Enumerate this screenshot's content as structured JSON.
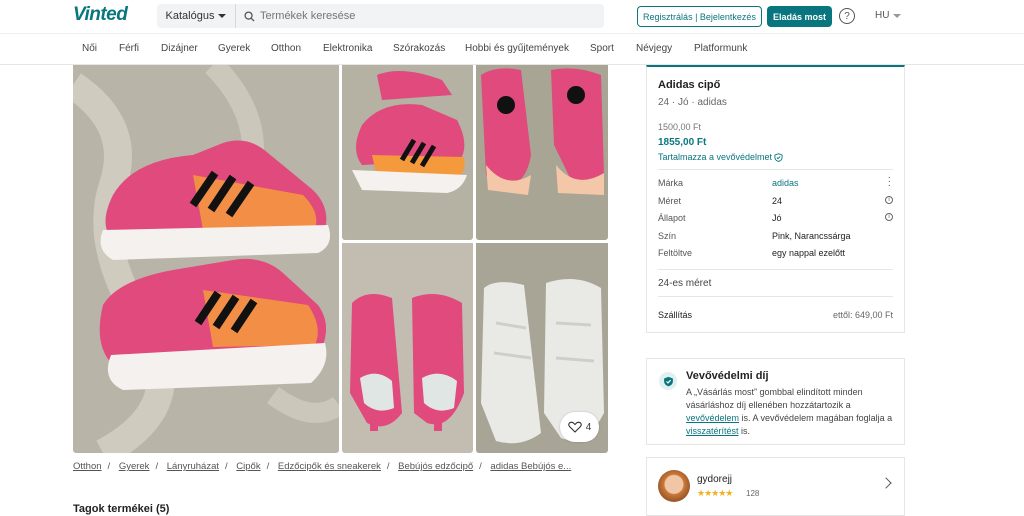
{
  "brand": "Vinted",
  "header": {
    "catalog_label": "Katalógus",
    "search_placeholder": "Termékek keresése",
    "register_label": "Regisztrálás | Bejelentkezés",
    "sell_label": "Eladás most",
    "help_icon": "question-circle-icon",
    "lang": "HU"
  },
  "nav": [
    "Női",
    "Férfi",
    "Dizájner",
    "Gyerek",
    "Otthon",
    "Elektronika",
    "Szórakozás",
    "Hobbi és gyűjtemények",
    "Sport",
    "Névjegy",
    "Platformunk"
  ],
  "gallery": {
    "favourites": "4",
    "heart_icon": "heart-outline-icon"
  },
  "breadcrumbs": [
    "Otthon",
    "Gyerek",
    "Lányruházat",
    "Cipők",
    "Edzőcipők és sneakerek",
    "Bebújós edzőcipő",
    "adidas Bebújós e..."
  ],
  "members_heading": "Tagok termékei (5)",
  "item": {
    "title": "Adidas cipő",
    "subtitle": "24 · Jó · adidas",
    "price": "1500,00 Ft",
    "price_with_protection": "1855,00 Ft",
    "protection_label": "Tartalmazza a vevővédelmet",
    "details": [
      {
        "key": "Márka",
        "value": "adidas"
      },
      {
        "key": "Méret",
        "value": "24"
      },
      {
        "key": "Állapot",
        "value": "Jó"
      },
      {
        "key": "Szín",
        "value": "Pink, Narancssárga"
      },
      {
        "key": "Feltöltve",
        "value": "egy nappal ezelőtt"
      }
    ],
    "size_desc": "24-es méret",
    "shipping_label": "Szállítás",
    "shipping_value": "ettől: 649,00 Ft"
  },
  "buyer_protection": {
    "title": "Vevővédelmi díj",
    "text1": "A „Vásárlás most” gombbal elindított minden vásárláshoz díj ellenében hozzátartozik a ",
    "link1": "vevővédelem",
    "text2": " is. A vevővédelem magában foglalja a ",
    "link2": "visszatérítést",
    "text3": " is."
  },
  "seller": {
    "name": "gydorejj",
    "stars": "★★★★★",
    "rating_count": "128"
  },
  "colors": {
    "accent": "#09767f",
    "star": "#f2b01e",
    "shoe_pink": "#e04a7c",
    "shoe_orange": "#f59a3c"
  }
}
